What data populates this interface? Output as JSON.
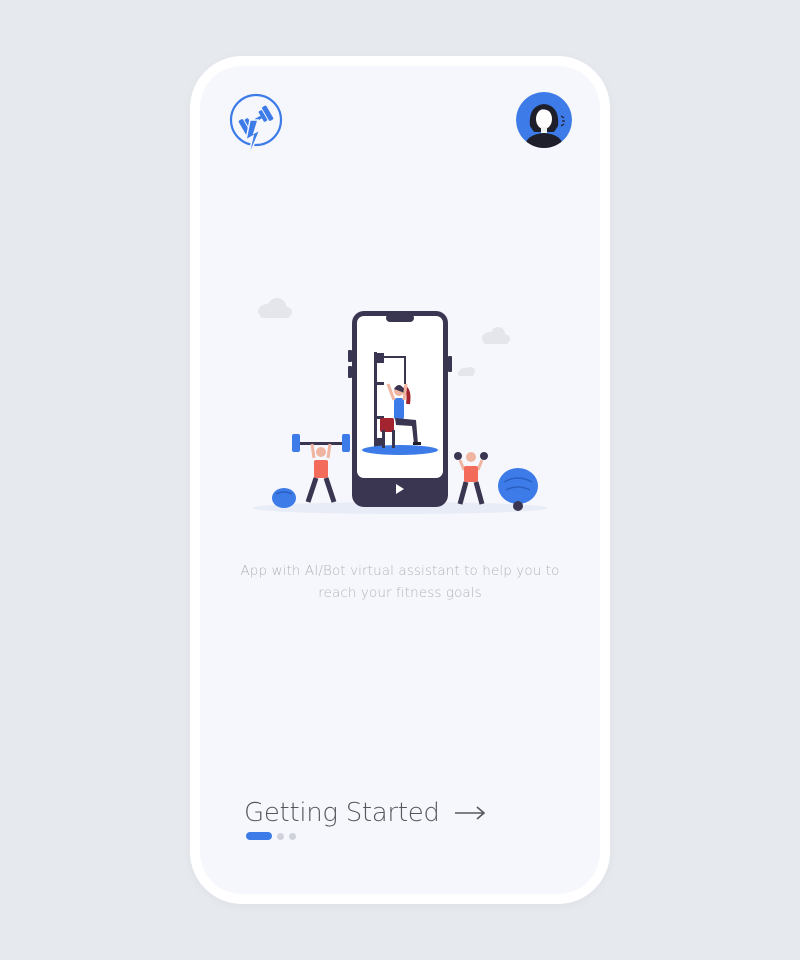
{
  "app": {
    "logo_icon": "dumbbell-lightning-icon",
    "avatar_icon": "user-avatar-icon"
  },
  "onboarding": {
    "description": "App with AI/Bot virtual assistant to help you to reach your fitness goals",
    "cta_label": "Getting Started",
    "cta_icon": "arrow-right-icon",
    "pagination": {
      "total": 3,
      "active": 0
    }
  },
  "colors": {
    "accent": "#3d7be8",
    "background": "#e6e9ee",
    "screen": "#f6f7fc",
    "text_muted": "#b0b3bb",
    "text_dark": "#55575e"
  }
}
